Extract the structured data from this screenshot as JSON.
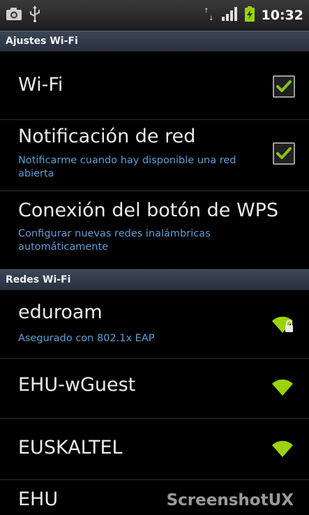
{
  "status_bar": {
    "time": "10:32",
    "icons": [
      "gallery-icon",
      "usb-icon",
      "data-transfer-icon",
      "signal-icon",
      "battery-icon"
    ]
  },
  "wifi_settings": {
    "header": "Ajustes Wi-Fi",
    "wifi": {
      "label": "Wi-Fi",
      "checked": true
    },
    "network_notification": {
      "label": "Notificación de red",
      "description": "Notificarme cuando hay disponible una red abierta",
      "checked": true
    },
    "wps": {
      "label": "Conexión del botón de WPS",
      "description": "Configurar nuevas redes inalámbricas automáticamente"
    }
  },
  "networks": {
    "header": "Redes Wi-Fi",
    "items": [
      {
        "ssid": "eduroam",
        "security": "Asegurado con 802.1x EAP",
        "locked": true
      },
      {
        "ssid": "EHU-wGuest",
        "locked": false
      },
      {
        "ssid": "EUSKALTEL",
        "locked": false
      },
      {
        "ssid": "EHU",
        "locked": false
      }
    ]
  },
  "watermark": "ScreenshotUX",
  "colors": {
    "accent_blue": "#5d9fd4",
    "check_green": "#86c11c",
    "wifi_green": "#9bd20c",
    "header_bg": "#313a49"
  }
}
